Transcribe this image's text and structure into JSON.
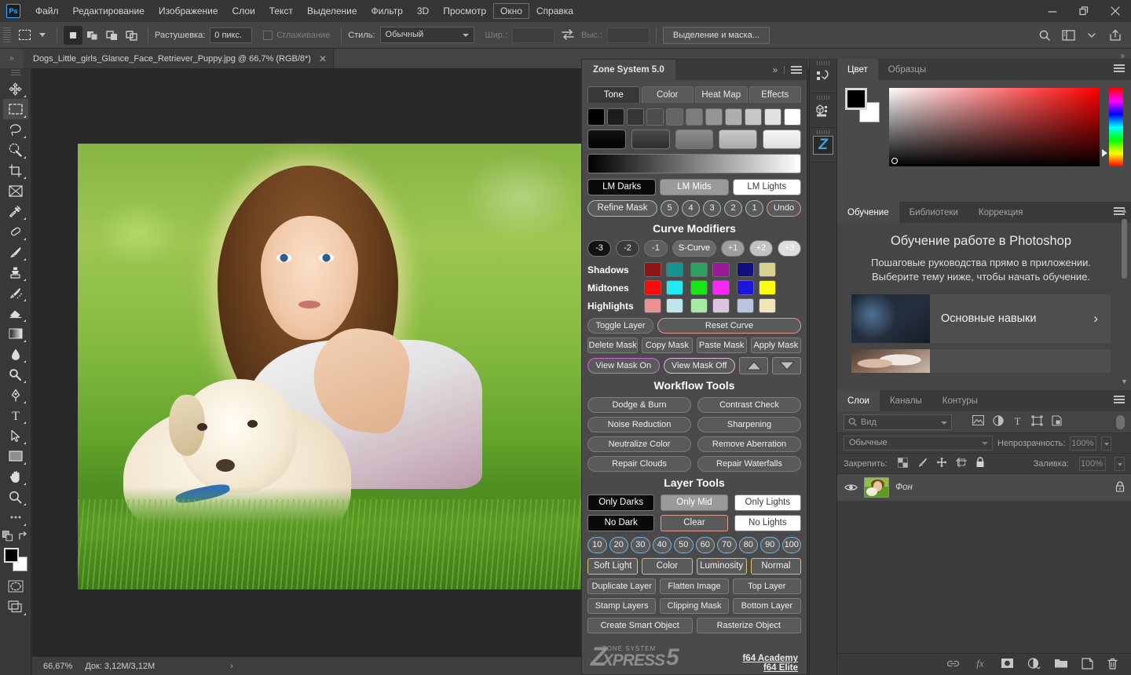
{
  "app": {
    "logo": "Ps",
    "menus": [
      "Файл",
      "Редактирование",
      "Изображение",
      "Слои",
      "Текст",
      "Выделение",
      "Фильтр",
      "3D",
      "Просмотр",
      "Окно",
      "Справка"
    ],
    "active_menu": "Окно",
    "window_controls": [
      "minimize-icon",
      "restore-icon",
      "close-icon"
    ]
  },
  "options_bar": {
    "tool_preset_icon": "rectangular-marquee-icon",
    "selection_modes": [
      "new-selection-icon",
      "add-to-selection-icon",
      "subtract-from-selection-icon",
      "intersect-selection-icon"
    ],
    "feather_label": "Растушевка:",
    "feather_value": "0 пикс.",
    "antialias_label": "Сглаживание",
    "style_label": "Стиль:",
    "style_value": "Обычный",
    "width_label": "Шир.:",
    "width_value": "",
    "swap_icon": "swap-dimensions-icon",
    "height_label": "Выс.:",
    "height_value": "",
    "select_and_mask": "Выделение и маска...",
    "right_icons": [
      "search-icon",
      "workspace-icon",
      "chevron-down-icon",
      "share-icon"
    ]
  },
  "document": {
    "tab_title": "Dogs_Little_girls_Glance_Face_Retriever_Puppy.jpg @ 66,7% (RGB/8*)",
    "close_icon": "close-icon",
    "collapse_icon": "collapse-panel-icon"
  },
  "status_bar": {
    "zoom": "66,67%",
    "doc_info": "Док: 3,12M/3,12M",
    "expand_icon": "chevron-right-icon"
  },
  "toolbar": {
    "tools": [
      {
        "name": "move-tool",
        "icon": "move-icon",
        "active": false
      },
      {
        "name": "rectangular-marquee-tool",
        "icon": "marquee-icon",
        "active": true
      },
      {
        "name": "lasso-tool",
        "icon": "lasso-icon",
        "active": false
      },
      {
        "name": "quick-selection-tool",
        "icon": "quick-select-icon",
        "active": false
      },
      {
        "name": "crop-tool",
        "icon": "crop-icon",
        "active": false
      },
      {
        "name": "frame-tool",
        "icon": "frame-icon",
        "active": false
      },
      {
        "name": "eyedropper-tool",
        "icon": "eyedropper-icon",
        "active": false
      },
      {
        "name": "healing-brush-tool",
        "icon": "healing-brush-icon",
        "active": false
      },
      {
        "name": "brush-tool",
        "icon": "brush-icon",
        "active": false
      },
      {
        "name": "clone-stamp-tool",
        "icon": "clone-stamp-icon",
        "active": false
      },
      {
        "name": "history-brush-tool",
        "icon": "history-brush-icon",
        "active": false
      },
      {
        "name": "eraser-tool",
        "icon": "eraser-icon",
        "active": false
      },
      {
        "name": "gradient-tool",
        "icon": "gradient-icon",
        "active": false
      },
      {
        "name": "blur-tool",
        "icon": "blur-drop-icon",
        "active": false
      },
      {
        "name": "dodge-tool",
        "icon": "dodge-icon",
        "active": false
      },
      {
        "name": "pen-tool",
        "icon": "pen-icon",
        "active": false
      },
      {
        "name": "type-tool",
        "icon": "type-icon",
        "active": false
      },
      {
        "name": "path-selection-tool",
        "icon": "path-arrow-icon",
        "active": false
      },
      {
        "name": "rectangle-tool",
        "icon": "rectangle-icon",
        "active": false
      },
      {
        "name": "hand-tool",
        "icon": "hand-icon",
        "active": false
      },
      {
        "name": "zoom-tool",
        "icon": "magnifier-icon",
        "active": false
      },
      {
        "name": "edit-toolbar",
        "icon": "ellipsis-icon",
        "active": false
      }
    ],
    "foreground_color": "#000000",
    "background_color": "#ffffff",
    "quickmask_icon": "quick-mask-icon",
    "screenmode_icon": "screen-mode-icon"
  },
  "zone_system": {
    "title": "Zone System 5.0",
    "header_icons": [
      "expand-icon",
      "panel-menu-icon"
    ],
    "tabs": [
      {
        "label": "Tone",
        "active": true
      },
      {
        "label": "Color",
        "active": false
      },
      {
        "label": "Heat Map",
        "active": false
      },
      {
        "label": "Effects",
        "active": false
      }
    ],
    "tone_swatches": [
      "#000000",
      "#1d1d1d",
      "#363636",
      "#4c4c4c",
      "#646464",
      "#7d7d7d",
      "#969696",
      "#aeaeae",
      "#c6c6c6",
      "#e2e2e2",
      "#ffffff"
    ],
    "tone_groups": [
      "#0d0d0d",
      "#3c3c3c",
      "#7e7e7e",
      "#b9b9b9",
      "#ececec"
    ],
    "gradient_bar": "black-to-white-gradient",
    "lm_buttons": [
      "LM Darks",
      "LM Mids",
      "LM Lights"
    ],
    "refine_mask": "Refine Mask",
    "refine_numbers": [
      "5",
      "4",
      "3",
      "2",
      "1"
    ],
    "undo": "Undo",
    "curve_modifiers_title": "Curve Modifiers",
    "curve_buttons": [
      "-3",
      "-2",
      "-1",
      "S-Curve",
      "+1",
      "+2",
      "+3"
    ],
    "color_rows": [
      {
        "label": "Shadows",
        "colors": [
          "#8d1515",
          "#169490",
          "#2da05e",
          "#9b1a9b",
          "#10117f",
          "#d8d392"
        ]
      },
      {
        "label": "Midtones",
        "colors": [
          "#fa0a0a",
          "#26e8f5",
          "#19e519",
          "#f826f8",
          "#1c16dd",
          "#fdfd12"
        ]
      },
      {
        "label": "Highlights",
        "colors": [
          "#f09191",
          "#bde7ec",
          "#a5eda5",
          "#ddc4e0",
          "#b9c6e2",
          "#f0e6b8"
        ]
      }
    ],
    "toggle_layer": "Toggle Layer",
    "reset_curve": "Reset Curve",
    "mask_buttons": [
      "Delete Mask",
      "Copy Mask",
      "Paste Mask",
      "Apply Mask"
    ],
    "view_mask_on": "View Mask On",
    "view_mask_off": "View Mask Off",
    "arrow_up_icon": "arrow-up-icon",
    "arrow_down_icon": "arrow-down-icon",
    "workflow_title": "Workflow Tools",
    "workflow_buttons": [
      [
        "Dodge & Burn",
        "Contrast Check"
      ],
      [
        "Noise Reduction",
        "Sharpening"
      ],
      [
        "Neutralize Color",
        "Remove Aberration"
      ],
      [
        "Repair Clouds",
        "Repair Waterfalls"
      ]
    ],
    "layer_tools_title": "Layer Tools",
    "layer_tone_row1": [
      "Only Darks",
      "Only Mid",
      "Only Lights"
    ],
    "layer_tone_row2": [
      "No Dark",
      "Clear",
      "No Lights"
    ],
    "percent_buttons": [
      "10",
      "20",
      "30",
      "40",
      "50",
      "60",
      "70",
      "80",
      "90",
      "100"
    ],
    "blend_buttons": [
      "Soft Light",
      "Color",
      "Luminosity",
      "Normal"
    ],
    "layer_ops": [
      [
        "Duplicate Layer",
        "Flatten Image",
        "Top Layer"
      ],
      [
        "Stamp Layers",
        "Clipping Mask",
        "Bottom Layer"
      ]
    ],
    "object_ops": [
      "Create Smart Object",
      "Rasterize Object"
    ],
    "logo": {
      "z": "Z",
      "zone_system": "ZONE SYSTEM",
      "express": "XPRESS",
      "five": "5"
    },
    "links": [
      "f64 Academy",
      "f64 Elite"
    ]
  },
  "icon_dock": {
    "items": [
      {
        "name": "history-dock-icon",
        "label": "history-icon"
      },
      {
        "name": "3d-dock-icon",
        "label": "cube-icon"
      },
      {
        "name": "zone-system-dock-icon",
        "label": "Z"
      }
    ]
  },
  "color_panel": {
    "tabs": [
      {
        "label": "Цвет",
        "active": true
      },
      {
        "label": "Образцы",
        "active": false
      }
    ],
    "menu_icon": "panel-menu-icon",
    "foreground": "#000000",
    "background": "#ffffff",
    "spectrum": "red-ramp-picker",
    "hue_slider": "hue-strip"
  },
  "learn_panel": {
    "tabs": [
      {
        "label": "Обучение",
        "active": true
      },
      {
        "label": "Библиотеки",
        "active": false
      },
      {
        "label": "Коррекция",
        "active": false
      }
    ],
    "menu_icon": "panel-menu-icon",
    "title": "Обучение работе в Photoshop",
    "subtitle": "Пошаговые руководства прямо в приложении. Выберите тему ниже, чтобы начать обучение.",
    "cards": [
      {
        "label": "Основные навыки",
        "chevron": "chevron-right-icon"
      },
      {
        "label": "",
        "chevron": ""
      }
    ],
    "scroll_up_icon": "chevron-up-icon",
    "scroll_down_icon": "chevron-down-icon"
  },
  "layers_panel": {
    "tabs": [
      {
        "label": "Слои",
        "active": true
      },
      {
        "label": "Каналы",
        "active": false
      },
      {
        "label": "Контуры",
        "active": false
      }
    ],
    "menu_icon": "panel-menu-icon",
    "filter_placeholder": "Вид",
    "filter_icons": [
      "image-filter-icon",
      "adjustment-filter-icon",
      "type-filter-icon",
      "shape-filter-icon",
      "smart-object-filter-icon"
    ],
    "filter_toggle": "filter-toggle-switch",
    "blend_mode": "Обычные",
    "opacity_label": "Непрозрачность:",
    "opacity_value": "100%",
    "lock_label": "Закрепить:",
    "lock_icons": [
      "lock-transparency-icon",
      "lock-image-icon",
      "lock-position-icon",
      "lock-artboard-icon",
      "lock-all-icon"
    ],
    "fill_label": "Заливка:",
    "fill_value": "100%",
    "layers": [
      {
        "name": "Фон",
        "visible": true,
        "locked": true,
        "thumbnail": "photo-thumbnail"
      }
    ],
    "bottom_icons": [
      "link-layers-icon",
      "layer-fx-icon",
      "layer-mask-icon",
      "adjustment-layer-icon",
      "new-group-icon",
      "new-layer-icon",
      "delete-layer-icon"
    ]
  }
}
